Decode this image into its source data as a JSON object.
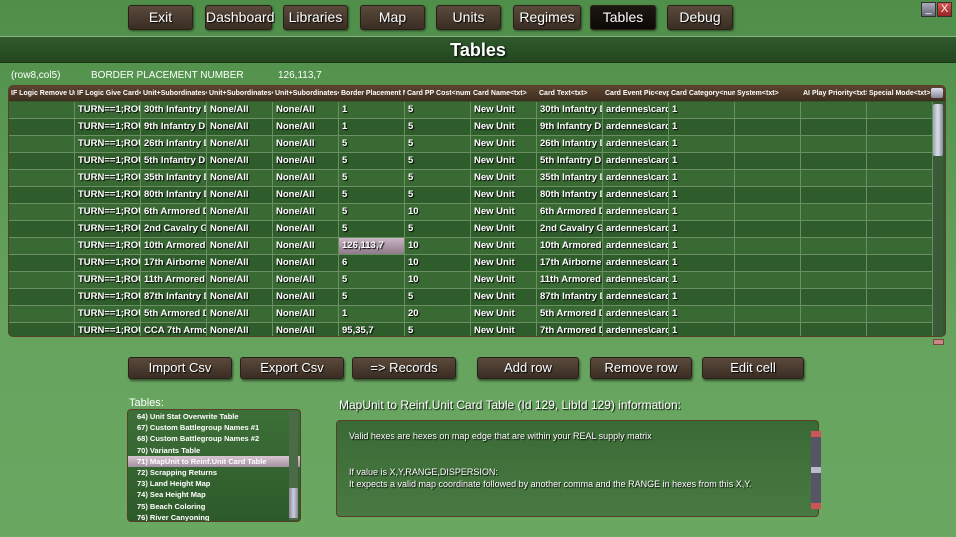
{
  "nav": [
    "Exit",
    "Dashboard",
    "Libraries",
    "Map",
    "Units",
    "Regimes",
    "Tables",
    "Debug"
  ],
  "active_nav": "Tables",
  "window": {
    "minimize": "_",
    "close": "X"
  },
  "title": "Tables",
  "cell_info": {
    "position": "(row8,col5)",
    "column": "BORDER PLACEMENT NUMBER",
    "value": "126,113,7"
  },
  "grid": {
    "headers": [
      "IF Logic Remove Un",
      "IF Logic Give Card<t",
      "Unit+Subordinates<",
      "Unit+Subordinates<",
      "Unit+Subordinates<",
      "Border Placement N",
      "Card PP Cost<num>",
      "Card Name<txt>",
      "Card Text<txt>",
      "Card Event Pic<evpi",
      "Card Category<num",
      "System<txt>",
      "AI Play Priority<txt>",
      "Special Mode<txt>"
    ],
    "rows": [
      [
        "",
        "TURN==1;ROU",
        "30th Infantry Di",
        "None/All",
        "None/All",
        "1",
        "5",
        "New Unit",
        "30th Infantry Di",
        "ardennes\\cards",
        "1",
        "",
        "",
        ""
      ],
      [
        "",
        "TURN==1;ROU",
        "9th Infantry Divi",
        "None/All",
        "None/All",
        "1",
        "5",
        "New Unit",
        "9th Infantry Divi",
        "ardennes\\cards",
        "1",
        "",
        "",
        ""
      ],
      [
        "",
        "TURN==1;ROU",
        "26th Infantry Di",
        "None/All",
        "None/All",
        "5",
        "5",
        "New Unit",
        "26th Infantry Di",
        "ardennes\\cards",
        "1",
        "",
        "",
        ""
      ],
      [
        "",
        "TURN==1;ROU",
        "5th Infantry Divi",
        "None/All",
        "None/All",
        "5",
        "5",
        "New Unit",
        "5th Infantry Divi",
        "ardennes\\cards",
        "1",
        "",
        "",
        ""
      ],
      [
        "",
        "TURN==1;ROU",
        "35th Infantry Di",
        "None/All",
        "None/All",
        "5",
        "5",
        "New Unit",
        "35th Infantry Di",
        "ardennes\\cards",
        "1",
        "",
        "",
        ""
      ],
      [
        "",
        "TURN==1;ROU",
        "80th Infantry Di",
        "None/All",
        "None/All",
        "5",
        "5",
        "New Unit",
        "80th Infantry Di",
        "ardennes\\cards",
        "1",
        "",
        "",
        ""
      ],
      [
        "",
        "TURN==1;ROU",
        "6th Armored Div",
        "None/All",
        "None/All",
        "5",
        "10",
        "New Unit",
        "6th Armored Div",
        "ardennes\\cards",
        "1",
        "",
        "",
        ""
      ],
      [
        "",
        "TURN==1;ROU",
        "2nd Cavalry Gr",
        "None/All",
        "None/All",
        "5",
        "5",
        "New Unit",
        "2nd Cavalry Gr",
        "ardennes\\cards",
        "1",
        "",
        "",
        ""
      ],
      [
        "",
        "TURN==1;ROU",
        "10th Armored D",
        "None/All",
        "None/All",
        "126,113,7",
        "10",
        "New Unit",
        "10th Armored D",
        "ardennes\\cards",
        "1",
        "",
        "",
        ""
      ],
      [
        "",
        "TURN==1;ROU",
        "17th Airborne D",
        "None/All",
        "None/All",
        "6",
        "10",
        "New Unit",
        "17th Airborne D",
        "ardennes\\cards",
        "1",
        "",
        "",
        ""
      ],
      [
        "",
        "TURN==1;ROU",
        "11th Armored D",
        "None/All",
        "None/All",
        "5",
        "10",
        "New Unit",
        "11th Armored D",
        "ardennes\\cards",
        "1",
        "",
        "",
        ""
      ],
      [
        "",
        "TURN==1;ROU",
        "87th Infantry Di",
        "None/All",
        "None/All",
        "5",
        "5",
        "New Unit",
        "87th Infantry Di",
        "ardennes\\cards",
        "1",
        "",
        "",
        ""
      ],
      [
        "",
        "TURN==1;ROU",
        "5th Armored Div",
        "None/All",
        "None/All",
        "1",
        "20",
        "New Unit",
        "5th Armored Div",
        "ardennes\\cards",
        "1",
        "",
        "",
        ""
      ],
      [
        "",
        "TURN==1;ROU",
        "CCA 7th Armor",
        "None/All",
        "None/All",
        "95,35,7",
        "5",
        "New Unit",
        "7th Armored Div",
        "ardennes\\cards",
        "1",
        "",
        "",
        ""
      ]
    ]
  },
  "buttons": {
    "import": "Import Csv",
    "export": "Export Csv",
    "records": "=> Records",
    "add_row": "Add row",
    "remove_row": "Remove row",
    "edit_cell": "Edit cell"
  },
  "tables_label": "Tables:",
  "tables": [
    "64) Unit Stat Overwrite Table",
    "67) Custom Battlegroup Names #1",
    "68) Custom Battlegroup Names #2",
    "70) Variants Table",
    "71) MapUnit to Reinf.Unit Card Table",
    "72) Scrapping Returns",
    "73) Land Height Map",
    "74) Sea Height Map",
    "75) Beach Coloring",
    "76) River Canyoning"
  ],
  "selected_table": "71) MapUnit to Reinf.Unit Card Table",
  "info_title": "MapUnit to Reinf.Unit Card Table (Id 129, LibId 129) information:",
  "info_lines": [
    "Valid hexes are hexes on map edge that are within your REAL supply matrix",
    "",
    "",
    "If value is X,Y,RANGE,DISPERSION:",
    "It expects a valid map coordinate followed by another comma and the RANGE in hexes from this X,Y."
  ]
}
